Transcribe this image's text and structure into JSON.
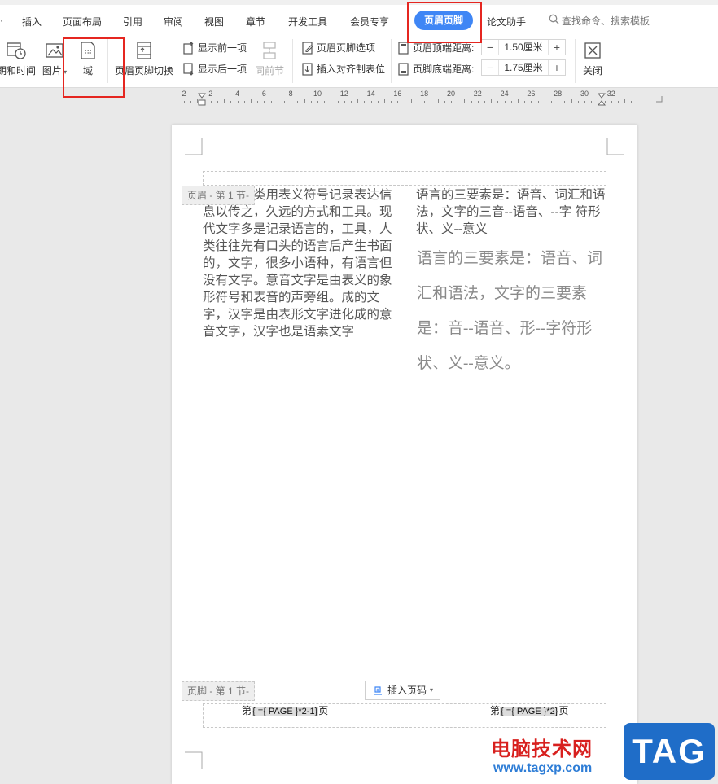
{
  "tabs": {
    "insert": "插入",
    "layout": "页面布局",
    "references": "引用",
    "review": "审阅",
    "view": "视图",
    "section": "章节",
    "developer": "开发工具",
    "member": "会员专享",
    "header_footer": "页眉页脚",
    "thesis": "论文助手",
    "search_placeholder": "查找命令、搜索模板"
  },
  "ribbon": {
    "datetime": "期和时间",
    "picture": "图片",
    "field": "域",
    "switch": "页眉页脚切换",
    "show_prev": "显示前一项",
    "show_next": "显示后一项",
    "same_as_prev": "同前节",
    "options": "页眉页脚选项",
    "insert_tab": "插入对齐制表位",
    "header_top_label": "页眉顶端距离:",
    "header_top_value": "1.50厘米",
    "footer_bottom_label": "页脚底端距离:",
    "footer_bottom_value": "1.75厘米",
    "minus": "−",
    "plus": "+",
    "close": "关闭"
  },
  "ruler": {
    "numbers": [
      "2",
      "2",
      "4",
      "6",
      "8",
      "10",
      "12",
      "14",
      "16",
      "18",
      "20",
      "22",
      "24",
      "26",
      "28",
      "30",
      "32"
    ]
  },
  "page": {
    "header_label": "页眉 - 第 1 节-",
    "footer_label": "页脚 - 第 1 节-",
    "left_text": "文字是人类用表义符号记录表达信息以传之，久远的方式和工具。现代文字多是记录语言的，工具，人类往往先有口头的语言后产生书面的，文字，很多小语种，有语言但没有文字。意音文字是由表义的象形符号和表音的声旁组。成的文字，汉字是由表形文字进化成的意音文字，汉字也是语素文字",
    "right_text": "语言的三要素是：语音、词汇和语法，文字的三音--语音、--字 符形状、义--意义",
    "right_serif": "语言的三要素是：语音、词汇和语法，文字的三要素是：音--语音、形--字符形状、义--意义。",
    "insert_page_number": "插入页码",
    "footer_left": {
      "prefix": "第",
      "code": "{ ={ PAGE }*2-1}",
      "suffix": "页"
    },
    "footer_right": {
      "prefix": "第",
      "code": "{ ={ PAGE }*2}",
      "suffix": "页"
    }
  },
  "watermark": {
    "site_name": "电脑技术网",
    "url": "www.tagxp.com",
    "tag": "TAG"
  },
  "colors": {
    "accent": "#3f86f5",
    "highlight": "#e52620"
  }
}
